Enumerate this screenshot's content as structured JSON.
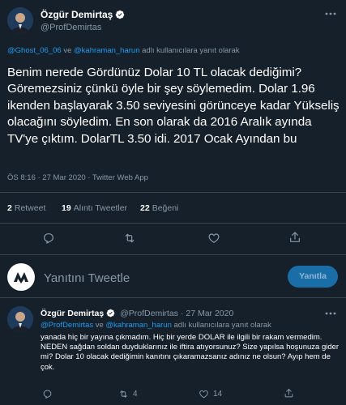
{
  "tweet": {
    "author_name": "Özgür Demirtaş",
    "author_handle": "@ProfDemirtas",
    "reply_to": {
      "user1": "@Ghost_06_06",
      "connector": " ve ",
      "user2": "@kahraman_harun",
      "suffix": " adlı kullanıcılara yanıt olarak"
    },
    "text": "Benim nerede Gördünüz Dolar 10 TL olacak dediğimi? Göremezsiniz çünkü öyle bir şey söylemedim. Dolar 1.96 ikenden başlayarak 3.50 seviyesini görünceye kadar Yükseliş olacağını söyledim. En son olarak da 2016 Aralık ayında TV'ye çıktım. DolarTL 3.50 idi. 2017 Ocak Ayından bu",
    "meta": "ÖS 8:16 · 27 Mar 2020 · Twitter Web App",
    "stats": {
      "retweet_count": "2",
      "retweet_label": "Retweet",
      "quote_count": "19",
      "quote_label": "Alıntı Tweetler",
      "like_count": "22",
      "like_label": "Beğeni"
    }
  },
  "composer": {
    "placeholder": "Yanıtını Tweetle",
    "reply_button": "Yanıtla"
  },
  "reply": {
    "author_name": "Özgür Demirtaş",
    "author_handle": "@ProfDemirtas",
    "date": "· 27 Mar 2020",
    "reply_to": {
      "user1": "@ProfDemirtas",
      "connector": " ve ",
      "user2": "@kahraman_harun",
      "suffix": " adlı kullanıcılara yanıt olarak"
    },
    "text": "yanada hiç bir yayına çıkmadım. Hiç bir yerde DOLAR ile ilgili bir rakam vermedim. NEDEN sağdan soldan duyduklarınız ile iftira atıyorsunuz? Size yapılsa hoşunuza gider mi? Dolar 10 olacak dediğimin kanıtını çıkaramazsanız adınız ne olsun? Ayıp hem de çok.",
    "retweet_count": "4",
    "like_count": "14"
  },
  "icons": {
    "more": "more-dots-icon",
    "verified": "verified-badge-icon",
    "reply": "reply-icon",
    "retweet": "retweet-icon",
    "like": "heart-icon",
    "share": "share-icon",
    "brand": "brand-logo"
  },
  "colors": {
    "background": "#15202b",
    "accent": "#1d9bf0",
    "muted": "#8899a6",
    "divider": "#38444d"
  }
}
